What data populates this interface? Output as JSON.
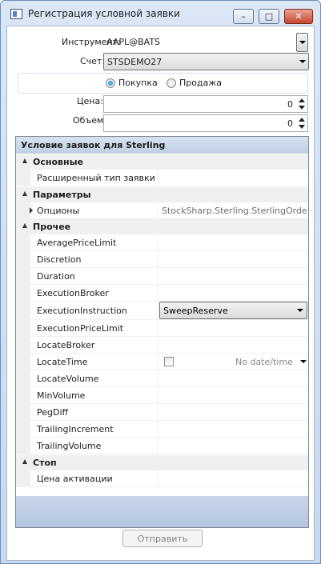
{
  "window": {
    "title": "Регистрация условной заявки",
    "minimize": "–",
    "maximize": "□",
    "close": "✕"
  },
  "form": {
    "instrument_label": "Инструмент:",
    "instrument_value": "AAPL@BATS",
    "account_label": "Счет:",
    "account_value": "STSDEMO27",
    "side_buy_label": "Покупка",
    "side_sell_label": "Продажа",
    "selected_side": "buy",
    "price_label": "Цена:",
    "price_value": "0",
    "volume_label": "Объем:",
    "volume_value": "0"
  },
  "property_grid": {
    "header": "Условие заявок для Sterling",
    "categories": {
      "basic": "Основные",
      "parameters": "Параметры",
      "other": "Прочее",
      "stop": "Стоп"
    },
    "rows": {
      "extended_order_type": "Расширенный тип заявки",
      "options": "Опционы",
      "options_value": "StockSharp.Sterling.SterlingOrderCondition+...",
      "average_price_limit": "AveragePriceLimit",
      "discretion": "Discretion",
      "duration": "Duration",
      "execution_broker": "ExecutionBroker",
      "execution_instruction": "ExecutionInstruction",
      "execution_instruction_value": "SweepReserve",
      "execution_price_limit": "ExecutionPriceLimit",
      "locate_broker": "LocateBroker",
      "locate_time": "LocateTime",
      "locate_time_value": "No date/time",
      "locate_volume": "LocateVolume",
      "min_volume": "MinVolume",
      "peg_diff": "PegDiff",
      "trailing_increment": "TrailingIncrement",
      "trailing_volume": "TrailingVolume",
      "activation_price": "Цена активации"
    }
  },
  "actions": {
    "submit_label": "Отправить"
  },
  "icons": [
    "app-window-icon",
    "minimize-icon",
    "maximize-icon",
    "close-icon",
    "dropdown-arrow-icon",
    "spin-up-icon",
    "spin-down-icon",
    "collapse-triangle-icon",
    "expand-triangle-icon",
    "checkbox-icon"
  ]
}
